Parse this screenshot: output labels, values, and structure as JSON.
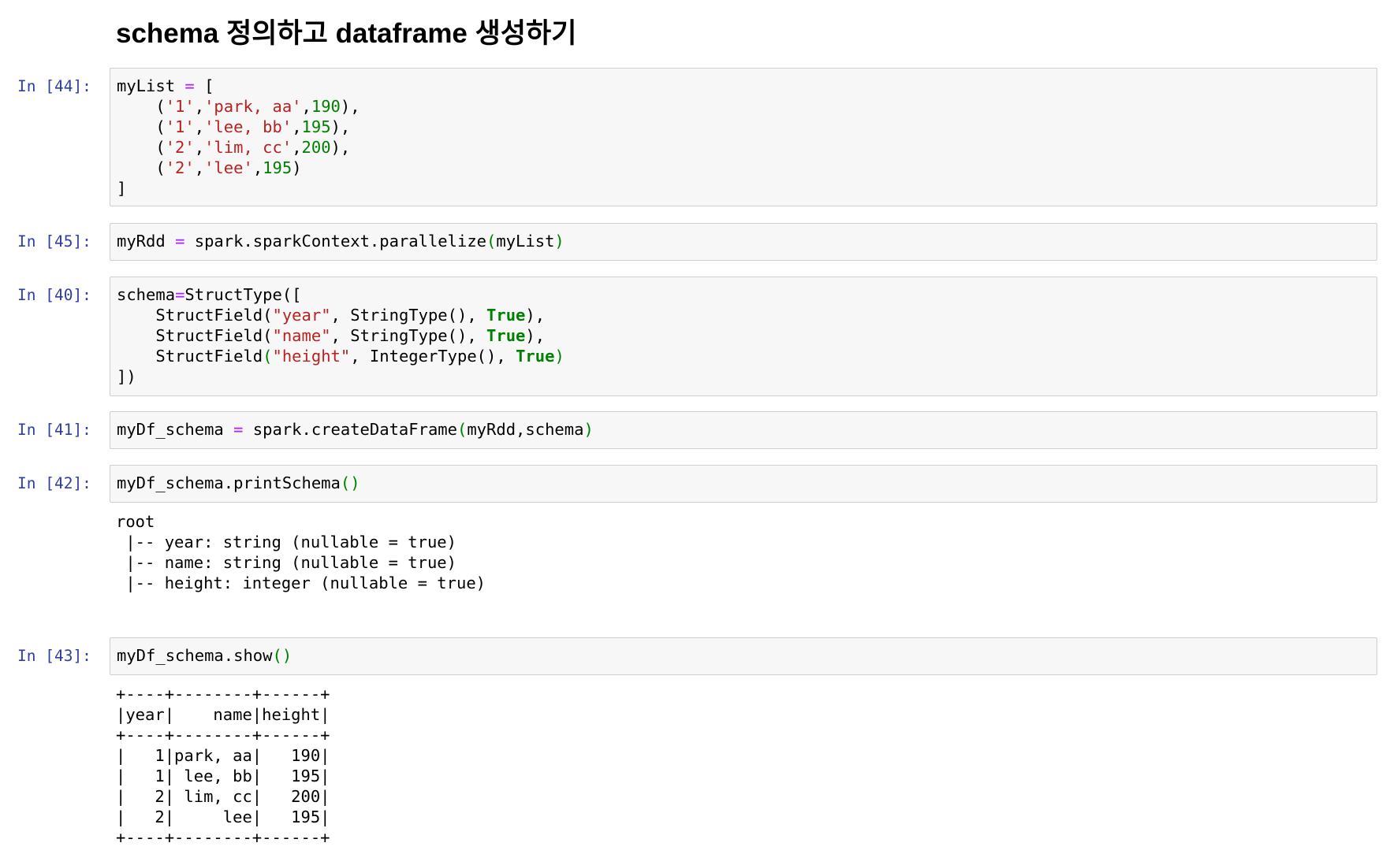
{
  "heading": "schema 정의하고 dataframe 생성하기",
  "cells": [
    {
      "prompt": "In [44]:",
      "lines": [
        [
          {
            "t": "myList "
          },
          {
            "t": "=",
            "c": "o"
          },
          {
            "t": " ["
          }
        ],
        [
          {
            "t": "    ("
          },
          {
            "t": "'1'",
            "c": "s"
          },
          {
            "t": ","
          },
          {
            "t": "'park, aa'",
            "c": "s"
          },
          {
            "t": ","
          },
          {
            "t": "190",
            "c": "n"
          },
          {
            "t": "),"
          }
        ],
        [
          {
            "t": "    ("
          },
          {
            "t": "'1'",
            "c": "s"
          },
          {
            "t": ","
          },
          {
            "t": "'lee, bb'",
            "c": "s"
          },
          {
            "t": ","
          },
          {
            "t": "195",
            "c": "n"
          },
          {
            "t": "),"
          }
        ],
        [
          {
            "t": "    ("
          },
          {
            "t": "'2'",
            "c": "s"
          },
          {
            "t": ","
          },
          {
            "t": "'lim, cc'",
            "c": "s"
          },
          {
            "t": ","
          },
          {
            "t": "200",
            "c": "n"
          },
          {
            "t": "),"
          }
        ],
        [
          {
            "t": "    ("
          },
          {
            "t": "'2'",
            "c": "s"
          },
          {
            "t": ","
          },
          {
            "t": "'lee'",
            "c": "s"
          },
          {
            "t": ","
          },
          {
            "t": "195",
            "c": "n"
          },
          {
            "t": ")"
          }
        ],
        [
          {
            "t": "]"
          }
        ]
      ]
    },
    {
      "prompt": "In [45]:",
      "lines": [
        [
          {
            "t": "myRdd "
          },
          {
            "t": "=",
            "c": "o"
          },
          {
            "t": " spark.sparkContext.parallelize"
          },
          {
            "t": "(",
            "c": "p"
          },
          {
            "t": "myList"
          },
          {
            "t": ")",
            "c": "p"
          }
        ]
      ]
    },
    {
      "prompt": "In [40]:",
      "lines": [
        [
          {
            "t": "schema"
          },
          {
            "t": "=",
            "c": "o"
          },
          {
            "t": "StructType(["
          }
        ],
        [
          {
            "t": "    StructField("
          },
          {
            "t": "\"year\"",
            "c": "s"
          },
          {
            "t": ", StringType(), "
          },
          {
            "t": "True",
            "c": "k"
          },
          {
            "t": "),"
          }
        ],
        [
          {
            "t": "    StructField("
          },
          {
            "t": "\"name\"",
            "c": "s"
          },
          {
            "t": ", StringType(), "
          },
          {
            "t": "True",
            "c": "k"
          },
          {
            "t": "),"
          }
        ],
        [
          {
            "t": "    StructField"
          },
          {
            "t": "(",
            "c": "p"
          },
          {
            "t": "\"height\"",
            "c": "s"
          },
          {
            "t": ", IntegerType(), "
          },
          {
            "t": "True",
            "c": "k"
          },
          {
            "t": ")",
            "c": "p"
          }
        ],
        [
          {
            "t": "])"
          }
        ]
      ]
    },
    {
      "prompt": "In [41]:",
      "lines": [
        [
          {
            "t": "myDf_schema "
          },
          {
            "t": "=",
            "c": "o"
          },
          {
            "t": " spark.createDataFrame"
          },
          {
            "t": "(",
            "c": "p"
          },
          {
            "t": "myRdd,schema"
          },
          {
            "t": ")",
            "c": "p"
          }
        ]
      ]
    },
    {
      "prompt": "In [42]:",
      "lines": [
        [
          {
            "t": "myDf_schema.printSchema"
          },
          {
            "t": "()",
            "c": "p"
          }
        ]
      ],
      "output": "root\n |-- year: string (nullable = true)\n |-- name: string (nullable = true)\n |-- height: integer (nullable = true)"
    },
    {
      "prompt": "In [43]:",
      "lines": [
        [
          {
            "t": "myDf_schema.show"
          },
          {
            "t": "()",
            "c": "p"
          }
        ]
      ],
      "output": "+----+--------+------+\n|year|    name|height|\n+----+--------+------+\n|   1|park, aa|   190|\n|   1| lee, bb|   195|\n|   2| lim, cc|   200|\n|   2|     lee|   195|\n+----+--------+------+"
    }
  ]
}
